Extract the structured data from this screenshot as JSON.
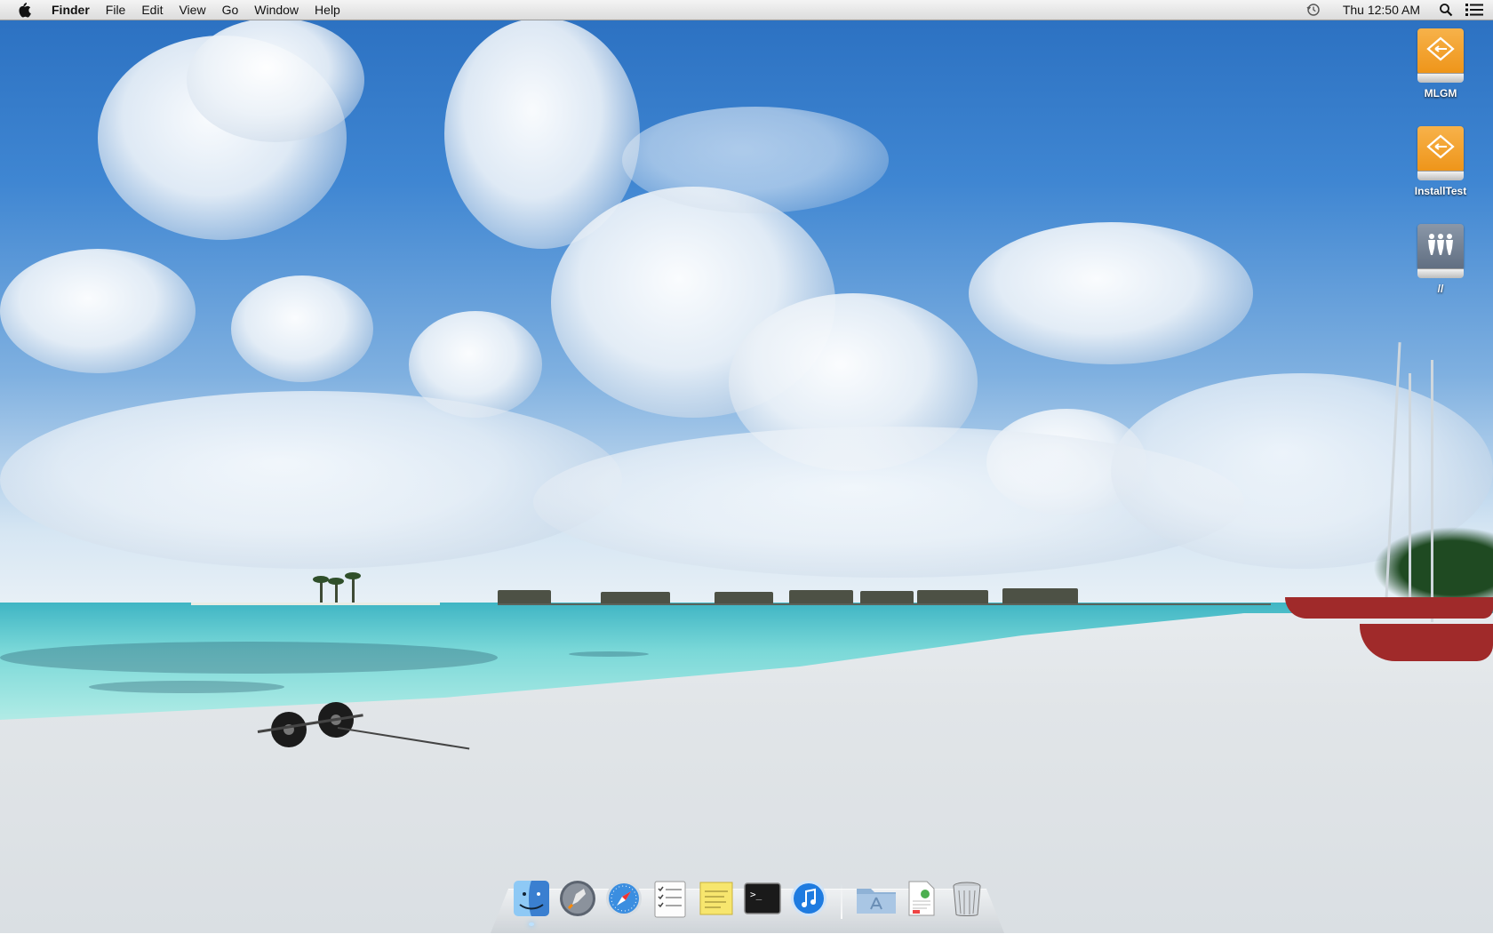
{
  "menubar": {
    "app_name": "Finder",
    "menus": [
      "File",
      "Edit",
      "View",
      "Go",
      "Window",
      "Help"
    ],
    "clock": "Thu 12:50 AM",
    "status_icons": [
      "time-machine-icon",
      "spotlight-icon",
      "notification-list-icon"
    ]
  },
  "desktop": {
    "icons": [
      {
        "label": "MLGM",
        "icon": "external-drive-icon"
      },
      {
        "label": "InstallTest",
        "icon": "external-drive-icon"
      },
      {
        "label": "//",
        "icon": "network-share-icon"
      }
    ]
  },
  "dock": {
    "apps": [
      {
        "name": "Finder",
        "icon": "finder-icon",
        "running": true
      },
      {
        "name": "Launchpad",
        "icon": "launchpad-icon",
        "running": false
      },
      {
        "name": "Safari",
        "icon": "safari-icon",
        "running": false
      },
      {
        "name": "Reminders",
        "icon": "reminders-icon",
        "running": false
      },
      {
        "name": "Stickies",
        "icon": "stickies-icon",
        "running": false
      },
      {
        "name": "Terminal",
        "icon": "terminal-icon",
        "running": false
      },
      {
        "name": "iTunes",
        "icon": "itunes-icon",
        "running": false
      }
    ],
    "stacks": [
      {
        "name": "Applications",
        "icon": "applications-folder-icon"
      },
      {
        "name": "Documents",
        "icon": "documents-stack-icon"
      },
      {
        "name": "Trash",
        "icon": "trash-icon"
      }
    ],
    "terminal_prompt": ">_"
  }
}
